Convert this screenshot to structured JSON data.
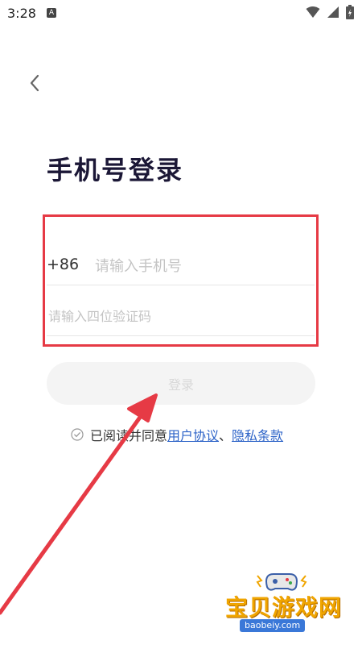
{
  "status_bar": {
    "time": "3:28",
    "notification_badge": "A"
  },
  "page": {
    "title": "手机号登录"
  },
  "form": {
    "country_code": "+86",
    "phone_placeholder": "请输入手机号",
    "code_placeholder": "请输入四位验证码"
  },
  "login_button": {
    "label": "登录"
  },
  "agreement": {
    "prefix": "已阅读并同意",
    "user_agreement": "用户协议",
    "separator": "、",
    "privacy_policy": "隐私条款"
  },
  "watermark": {
    "title": "宝贝游戏网",
    "url": "baobeiy.com"
  },
  "colors": {
    "annotation_red": "#e63a45",
    "link_blue": "#2e64c8",
    "title": "#1b1736"
  }
}
